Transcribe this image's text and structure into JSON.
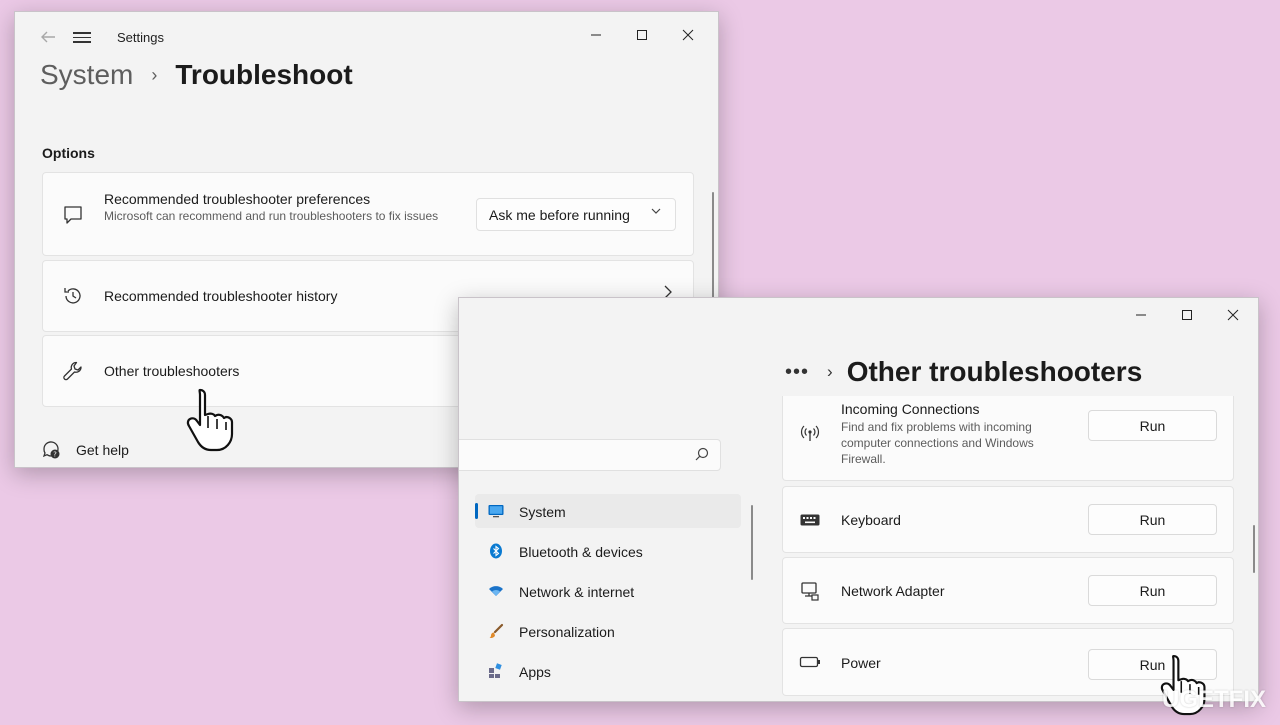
{
  "window1": {
    "app_title": "Settings",
    "caption": {
      "minimize": "—",
      "maximize": "☐",
      "close": "✕"
    },
    "breadcrumb": {
      "parent": "System",
      "separator": "›",
      "current": "Troubleshoot"
    },
    "section_label": "Options",
    "cards": [
      {
        "icon": "chat-bubble-icon",
        "title": "Recommended troubleshooter preferences",
        "description": "Microsoft can recommend and run troubleshooters to fix issues",
        "dropdown_value": "Ask me before running"
      },
      {
        "icon": "history-icon",
        "title": "Recommended troubleshooter history"
      },
      {
        "icon": "wrench-icon",
        "title": "Other troubleshooters"
      }
    ],
    "get_help": "Get help"
  },
  "window2": {
    "caption": {
      "minimize": "—",
      "maximize": "☐",
      "close": "✕"
    },
    "breadcrumb": {
      "ellipsis": "•••",
      "separator": "›",
      "current": "Other troubleshooters"
    },
    "sidebar": {
      "items": [
        {
          "label": "System",
          "icon": "monitor-icon",
          "active": true,
          "color": "#0067c0"
        },
        {
          "label": "Bluetooth & devices",
          "icon": "bluetooth-icon",
          "active": false,
          "color": "#0a7ad1"
        },
        {
          "label": "Network & internet",
          "icon": "wifi-icon",
          "active": false,
          "color": "#1a73c9"
        },
        {
          "label": "Personalization",
          "icon": "brush-icon",
          "active": false,
          "color": "#e08a2b"
        },
        {
          "label": "Apps",
          "icon": "apps-icon",
          "active": false,
          "color": "#6b6b8a"
        }
      ]
    },
    "troubleshooters": [
      {
        "name": "Incoming Connections",
        "icon": "antenna-icon",
        "description": "Find and fix problems with incoming computer connections and Windows Firewall.",
        "button": "Run"
      },
      {
        "name": "Keyboard",
        "icon": "keyboard-icon",
        "button": "Run"
      },
      {
        "name": "Network Adapter",
        "icon": "network-adapter-icon",
        "button": "Run"
      },
      {
        "name": "Power",
        "icon": "battery-icon",
        "button": "Run"
      }
    ]
  },
  "watermark": "UGETFIX"
}
